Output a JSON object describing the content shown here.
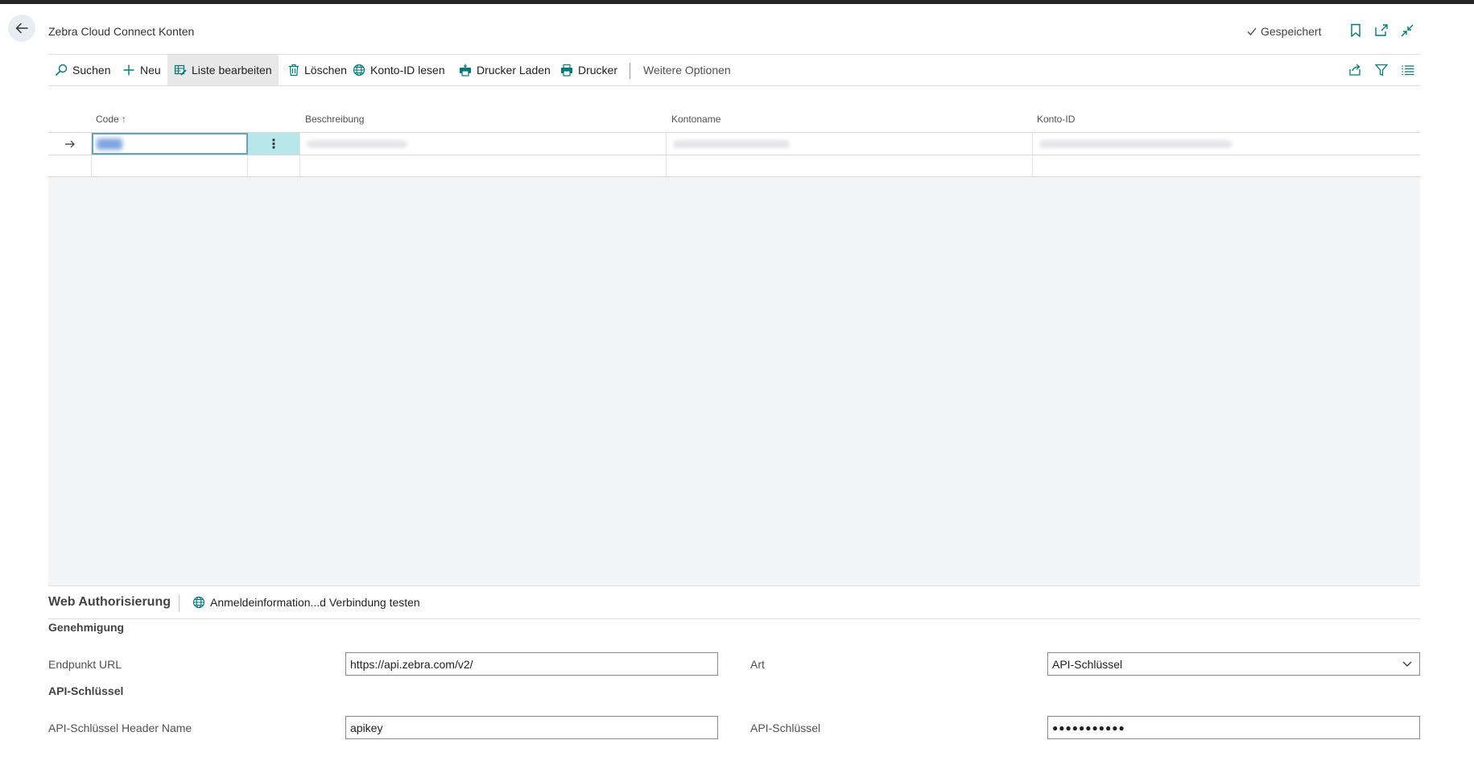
{
  "header": {
    "title": "Zebra Cloud Connect Konten",
    "saved_label": "Gespeichert",
    "icons": [
      "back-arrow-icon",
      "checkmark-icon",
      "bookmark-icon",
      "open-new-window-icon",
      "collapse-icon"
    ]
  },
  "actionbar": {
    "search": "Suchen",
    "new": "Neu",
    "edit_list": "Liste bearbeiten",
    "delete": "Löschen",
    "read_account_id": "Konto-ID lesen",
    "load_printers": "Drucker Laden",
    "printers": "Drucker",
    "more_options": "Weitere Optionen"
  },
  "table": {
    "columns": [
      "Code",
      "Beschreibung",
      "Kontoname",
      "Konto-ID"
    ],
    "sort_indicator": "↑",
    "rows": [
      {
        "selected": true,
        "code": "",
        "beschreibung": "",
        "kontoname": "",
        "konto_id": ""
      },
      {
        "selected": false,
        "code": "",
        "beschreibung": "",
        "kontoname": "",
        "konto_id": ""
      }
    ]
  },
  "web_auth": {
    "title": "Web Authorisierung",
    "test_action": "Anmeldeinformation...d Verbindung testen"
  },
  "genehmigung": {
    "heading": "Genehmigung",
    "endpoint_label": "Endpunkt URL",
    "endpoint_value": "https://api.zebra.com/v2/",
    "type_label": "Art",
    "type_value": "API-Schlüssel"
  },
  "api_key": {
    "heading": "API-Schlüssel",
    "header_name_label": "API-Schlüssel Header Name",
    "header_name_value": "apikey",
    "key_label": "API-Schlüssel",
    "key_value": "●●●●●●●●●●●"
  },
  "colors": {
    "accent": "#00797b",
    "active_cell": "#b7e7ea",
    "grid_background": "#f3f4f5"
  }
}
